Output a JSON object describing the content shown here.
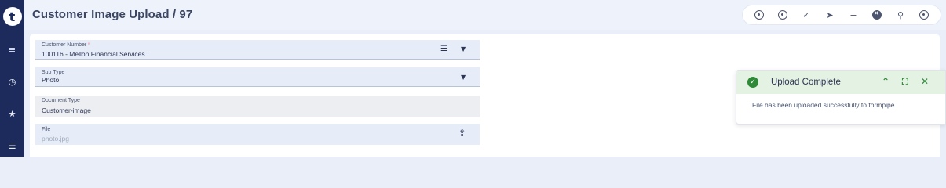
{
  "header": {
    "title": "Customer Image Upload / 97"
  },
  "rail": {
    "logo": "t"
  },
  "toolbar": {
    "icons": [
      "history-icon",
      "cancel-icon",
      "check-icon",
      "send-icon",
      "minus-icon",
      "delete-icon",
      "search-icon",
      "info-icon"
    ]
  },
  "form": {
    "customer_number": {
      "label": "Customer Number",
      "required_mark": "*",
      "value": "100116 - Mellon Financial Services"
    },
    "sub_type": {
      "label": "Sub Type",
      "value": "Photo"
    },
    "document_type": {
      "label": "Document Type",
      "value": "Customer-image"
    },
    "file": {
      "label": "File",
      "placeholder": "photo.jpg"
    }
  },
  "toast": {
    "title": "Upload Complete",
    "message": "File has been uploaded successfully to formpipe",
    "status_color": "#2e8a37"
  }
}
